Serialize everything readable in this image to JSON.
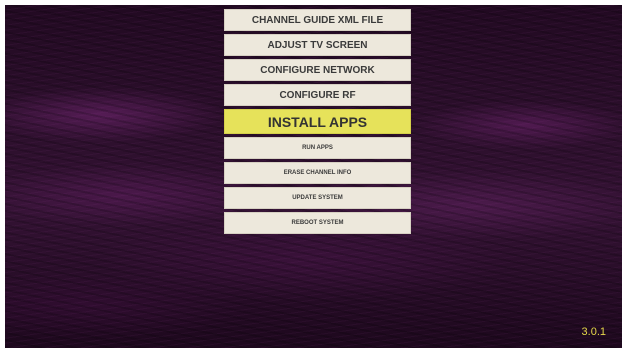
{
  "menu": {
    "items": [
      {
        "label": "CHANNEL GUIDE XML FILE",
        "selected": false
      },
      {
        "label": "ADJUST TV SCREEN",
        "selected": false
      },
      {
        "label": "CONFIGURE NETWORK",
        "selected": false
      },
      {
        "label": "CONFIGURE RF",
        "selected": false
      },
      {
        "label": "INSTALL APPS",
        "selected": true
      },
      {
        "label": "RUN APPS",
        "selected": false
      },
      {
        "label": "ERASE CHANNEL INFO",
        "selected": false
      },
      {
        "label": "UPDATE SYSTEM",
        "selected": false
      },
      {
        "label": "REBOOT SYSTEM",
        "selected": false
      }
    ]
  },
  "version": "3.0.1",
  "colors": {
    "menu_bg": "#ede8dc",
    "selected_bg": "#e6e25a",
    "version_text": "#e5d84a",
    "background": "#2c0f2c"
  }
}
